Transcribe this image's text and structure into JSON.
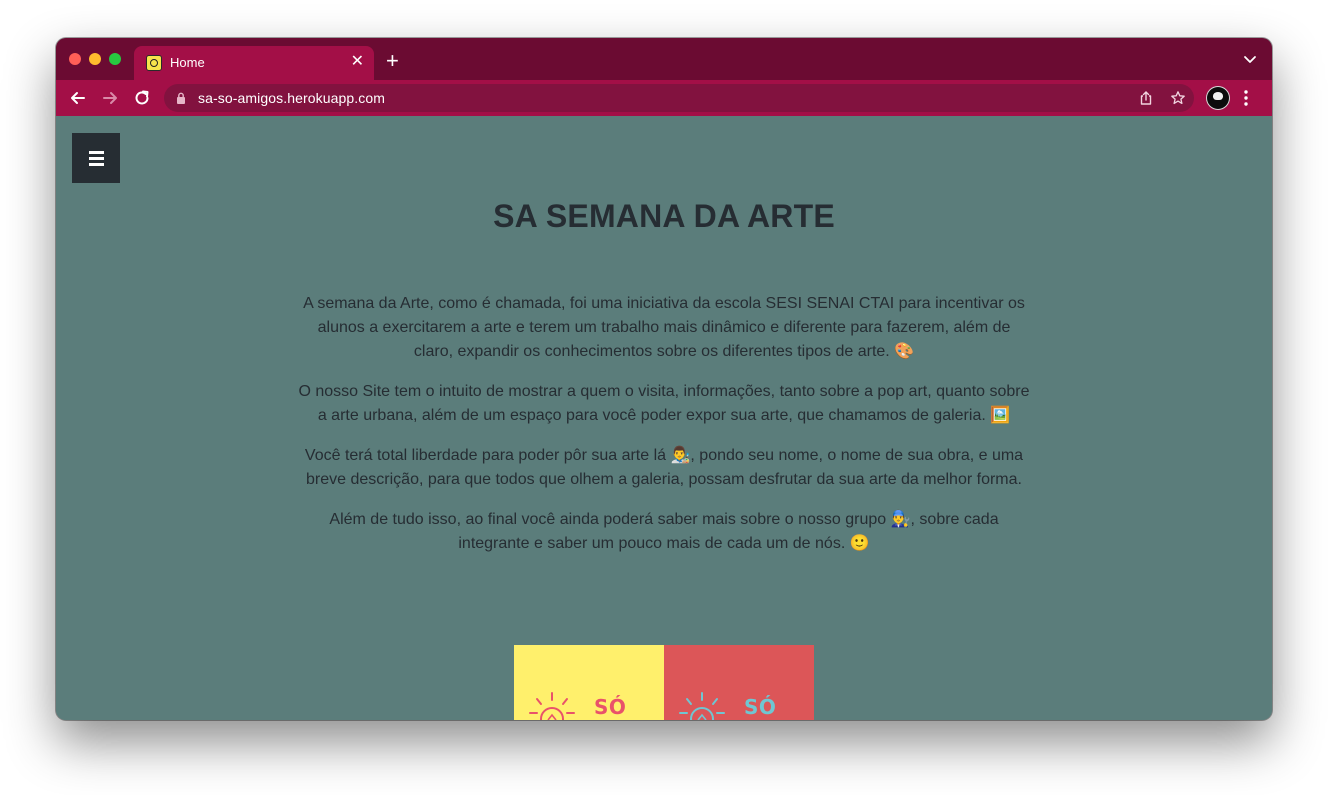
{
  "browser": {
    "tab": {
      "title": "Home",
      "close_glyph": "✕",
      "favicon": "site-favicon"
    },
    "new_tab_glyph": "+",
    "address": {
      "url": "sa-so-amigos.herokuapp.com"
    },
    "icons": [
      "back-arrow-icon",
      "forward-arrow-icon",
      "reload-icon",
      "lock-icon",
      "share-icon",
      "bookmark-star-icon",
      "profile-avatar",
      "kebab-menu-icon",
      "tab-search-icon"
    ]
  },
  "page": {
    "title": "SA SEMANA DA ARTE",
    "paragraphs": [
      {
        "text": "A semana da Arte, como é chamada, foi uma iniciativa da escola SESI SENAI CTAI para incentivar os alunos a exercitarem a arte e terem um trabalho mais dinâmico e diferente para fazerem, além de claro, expandir os conhecimentos sobre os diferentes tipos de arte. 🎨"
      },
      {
        "text": "O nosso Site tem o intuito de mostrar a quem o visita, informações, tanto sobre a pop art, quanto sobre a arte urbana, além de um espaço para você poder expor sua arte, que chamamos de galeria. 🖼️"
      },
      {
        "text": "Você terá total liberdade para poder pôr sua arte lá 👨‍🎨, pondo seu nome, o nome de sua obra, e uma breve descrição, para que todos que olhem a galeria, possam desfrutar da sua arte da melhor forma."
      },
      {
        "text": "Além de tudo isso, ao final você ainda poderá saber mais sobre o nosso grupo 👨‍🔧, sobre cada integrante e saber um pouco mais de cada um de nós. 🙂"
      }
    ],
    "cards": [
      {
        "label": "SÓ",
        "background": "#fff06c",
        "accent": "#e9526a"
      },
      {
        "label": "SÓ",
        "background": "#dc5658",
        "accent": "#6fc6d2"
      }
    ]
  },
  "colors": {
    "tabstrip": "#6b0b32",
    "toolbar": "#a30f47",
    "page_background": "#5b7d7b",
    "text": "#262d33"
  }
}
